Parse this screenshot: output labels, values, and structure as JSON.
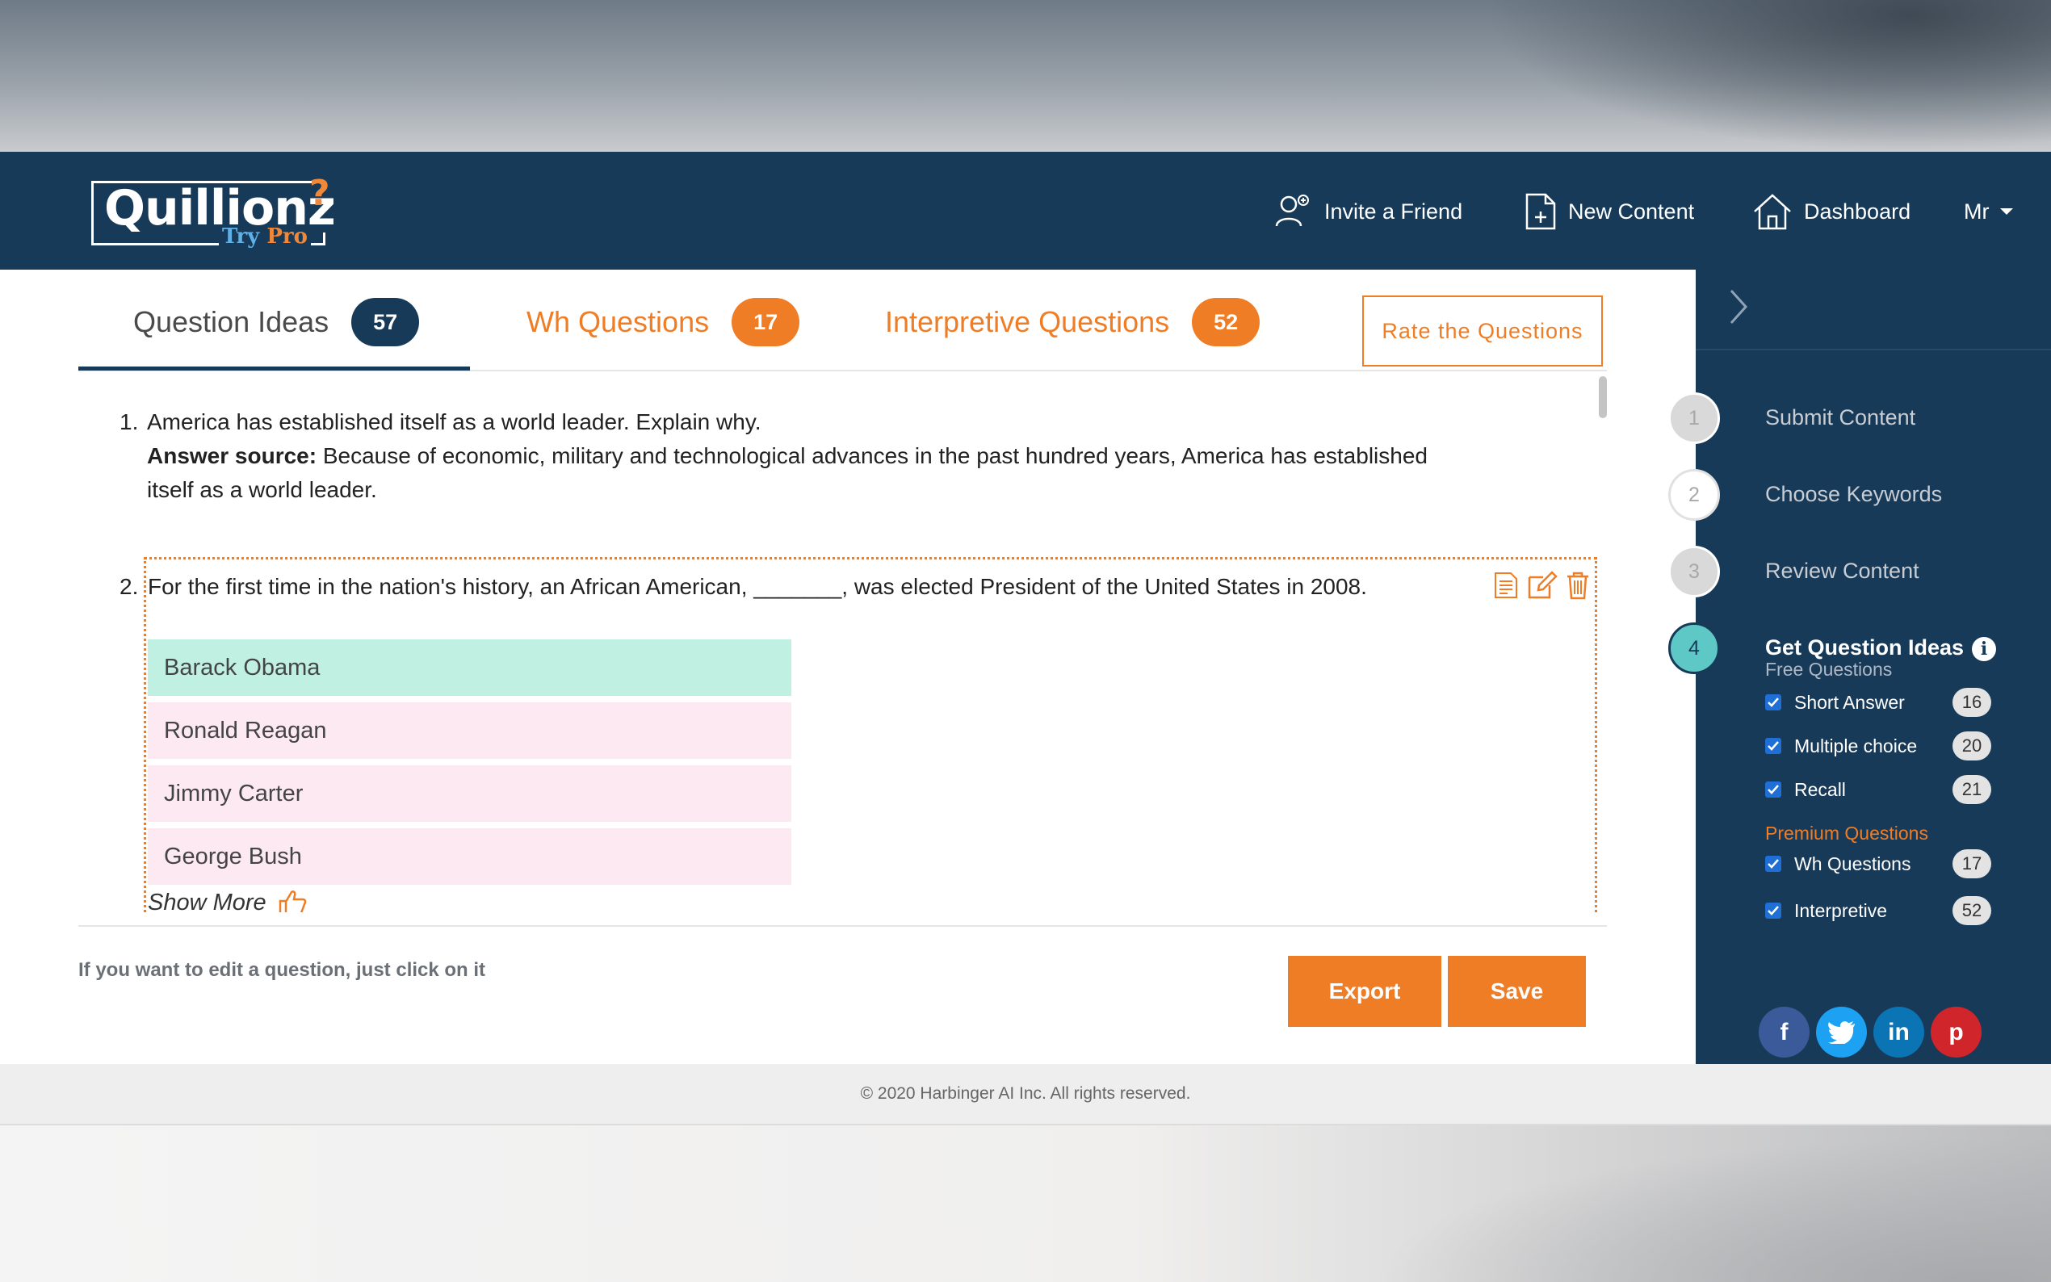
{
  "brand": {
    "name": "Quillionz",
    "tag_try": "Try",
    "tag_pro": "Pro"
  },
  "nav": {
    "invite": "Invite a Friend",
    "new_content": "New Content",
    "dashboard": "Dashboard",
    "user": "Mr"
  },
  "tabs": [
    {
      "label": "Question Ideas",
      "count": "57"
    },
    {
      "label": "Wh Questions",
      "count": "17"
    },
    {
      "label": "Interpretive Questions",
      "count": "52"
    }
  ],
  "rate_button": "Rate the Questions",
  "questions": {
    "q1": {
      "number": "1.",
      "text": "America has established itself as a world leader. Explain why.",
      "answer_label": "Answer source:",
      "answer_text": " Because of economic, military and technological advances in the past hundred years, America has established itself as a world leader."
    },
    "q2": {
      "number": "2.",
      "text": "For the first time in the nation's history, an African American, _______, was elected President of the United States in 2008.",
      "options": [
        "Barack Obama",
        "Ronald Reagan",
        "Jimmy Carter",
        "George Bush"
      ],
      "correct_index": 0,
      "show_more": "Show More"
    }
  },
  "hint": "If you want to edit a question, just click on it",
  "buttons": {
    "export": "Export",
    "save": "Save"
  },
  "steps": [
    {
      "number": "1",
      "label": "Submit Content"
    },
    {
      "number": "2",
      "label": "Choose Keywords"
    },
    {
      "number": "3",
      "label": "Review Content"
    },
    {
      "number": "4",
      "label": "Get Question Ideas"
    }
  ],
  "free_section": {
    "title": "Free Questions",
    "items": [
      {
        "name": "Short Answer",
        "count": "16",
        "checked": true
      },
      {
        "name": "Multiple choice",
        "count": "20",
        "checked": true
      },
      {
        "name": "Recall",
        "count": "21",
        "checked": true
      }
    ]
  },
  "premium_section": {
    "title": "Premium Questions",
    "items": [
      {
        "name": "Wh Questions",
        "count": "17",
        "checked": true
      },
      {
        "name": "Interpretive",
        "count": "52",
        "checked": true
      }
    ]
  },
  "social": {
    "facebook": "f",
    "twitter": "t",
    "linkedin": "in",
    "pinterest": "p"
  },
  "footer": "© 2020 Harbinger AI Inc. All rights reserved.",
  "colors": {
    "navy": "#183a59",
    "orange": "#ef7d26",
    "correct": "#c0f0e2",
    "incorrect": "#fde9f2",
    "teal": "#5dc8c6"
  }
}
